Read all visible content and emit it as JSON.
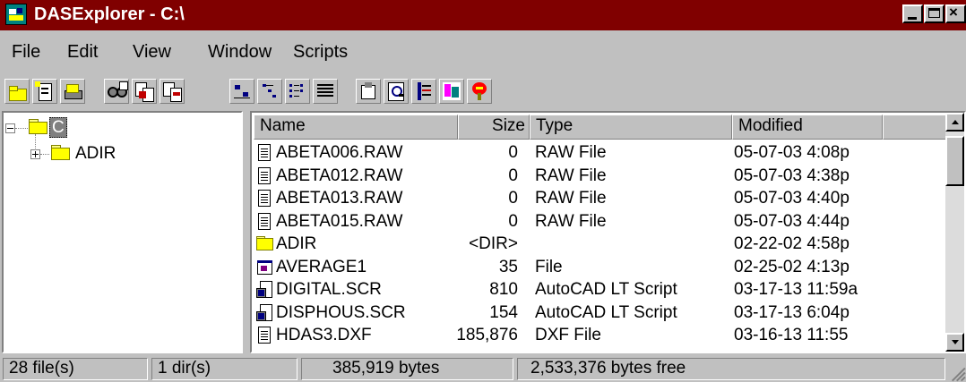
{
  "window": {
    "title": "DASExplorer - C:\\"
  },
  "menu": {
    "items": [
      "File",
      "Edit",
      "View",
      "Window",
      "Scripts"
    ]
  },
  "toolbar": {
    "icons": [
      "new-folder-icon",
      "properties-icon",
      "drive-icon",
      "find-icon",
      "copy-icon",
      "move-icon",
      "large-icons-view-icon",
      "small-icons-view-icon",
      "list-view-icon",
      "details-view-icon",
      "about-icon",
      "zoom-icon",
      "book-icon",
      "settings-icon",
      "script-run-icon"
    ]
  },
  "tree": {
    "root_label": "C",
    "child_label": "ADIR"
  },
  "list": {
    "columns": [
      "Name",
      "Size",
      "Type",
      "Modified"
    ],
    "rows": [
      {
        "name": "ABETA006.RAW",
        "size": "0",
        "type": "RAW File",
        "modified": "05-07-03  4:08p",
        "icon": "document-icon"
      },
      {
        "name": "ABETA012.RAW",
        "size": "0",
        "type": "RAW File",
        "modified": "05-07-03  4:38p",
        "icon": "document-icon"
      },
      {
        "name": "ABETA013.RAW",
        "size": "0",
        "type": "RAW File",
        "modified": "05-07-03  4:40p",
        "icon": "document-icon"
      },
      {
        "name": "ABETA015.RAW",
        "size": "0",
        "type": "RAW File",
        "modified": "05-07-03  4:44p",
        "icon": "document-icon"
      },
      {
        "name": "ADIR",
        "size": "<DIR>",
        "type": "",
        "modified": "02-22-02  4:58p",
        "icon": "folder-icon"
      },
      {
        "name": "AVERAGE1",
        "size": "35",
        "type": " File",
        "modified": "02-25-02  4:13p",
        "icon": "program-icon"
      },
      {
        "name": "DIGITAL.SCR",
        "size": "810",
        "type": "AutoCAD LT Script",
        "modified": "03-17-13 11:59a",
        "icon": "script-icon"
      },
      {
        "name": "DISPHOUS.SCR",
        "size": "154",
        "type": "AutoCAD LT Script",
        "modified": "03-17-13  6:04p",
        "icon": "script-icon"
      },
      {
        "name": "HDAS3.DXF",
        "size": "185,876",
        "type": "DXF File",
        "modified": "03-16-13 11:55",
        "icon": "document-icon"
      }
    ]
  },
  "status": {
    "files": "28 file(s)",
    "dirs": "1 dir(s)",
    "bytes": "385,919 bytes",
    "free": "2,533,376 bytes free"
  },
  "colors": {
    "titlebar": "#800000",
    "face": "#c0c0c0",
    "folder": "#ffff00"
  }
}
